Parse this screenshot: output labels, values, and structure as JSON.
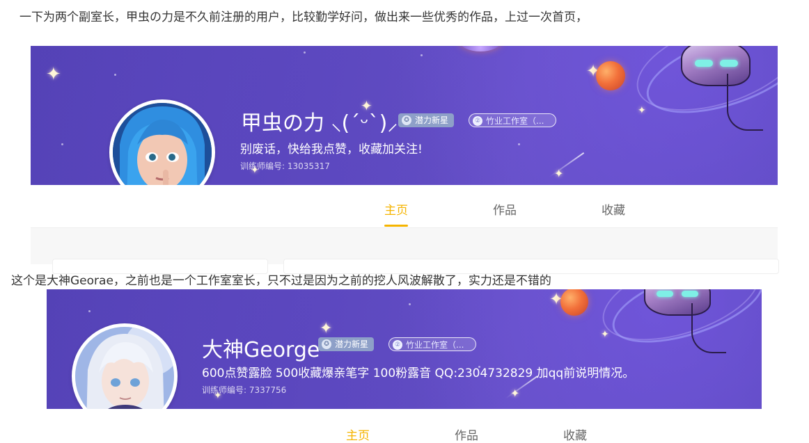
{
  "captions": {
    "first": "一下为两个副室长，甲虫の力是不久前注册的用户，比较勤学好问，做出来一些优秀的作品，上过一次首页，",
    "second": "这个是大神Georae，之前也是一个工作室室长，只不过是因为之前的挖人风波解散了，实力还是不错的"
  },
  "profiles": [
    {
      "username": "甲虫の力 ⸜(ˊᵕˋ)⸝",
      "badges": {
        "rising_star": "潜力新星",
        "studio": "竹业工作室（..."
      },
      "motto": "别废话，快给我点赞，收藏加关注!",
      "trainer_id": "训练师编号: 13035317",
      "tabs": [
        "主页",
        "作品",
        "收藏"
      ],
      "active_tab": "主页"
    },
    {
      "username": "大神George",
      "badges": {
        "rising_star": "潜力新星",
        "studio": "竹业工作室（..."
      },
      "motto": "600点赞露脸 500收藏爆亲笔字 100粉露音 QQ:2304732829 加qq前说明情况。",
      "trainer_id": "训练师编号: 7337756",
      "tabs": [
        "主页",
        "作品",
        "收藏"
      ],
      "active_tab": "主页"
    }
  ],
  "colors": {
    "banner": "#5c48bf",
    "active_tab": "#f5b400",
    "badge_star": "#8ea0c8"
  }
}
